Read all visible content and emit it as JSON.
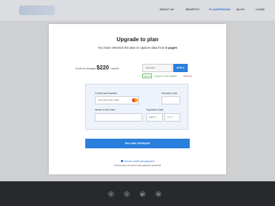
{
  "nav": {
    "items": [
      "ABOUT US",
      "BENEFITS",
      "PLANS/PRICING",
      "BLOG",
      "LOGIN"
    ],
    "active": "PLANS/PRICING"
  },
  "modal": {
    "title": "Upgrade to plan",
    "subtitle_pre": "You have selected the plan to capture data from ",
    "subtitle_bold": "3 pages",
    "charged_pre": "You'll be charged",
    "charged_amount": "$220",
    "charged_post": "/ month",
    "coupon_placeholder": "ABT4MK",
    "apply_label": "APPLY",
    "discount_badge": "15% off",
    "coupon_applied": "Coupon Code Applied",
    "remove_label": "Remove"
  },
  "payment": {
    "card_number_label": "Credit Card Number",
    "card_number_placeholder": "1234 5678 9012 3456",
    "security_code_label": "Security Code",
    "name_label": "Name on the Card",
    "expiration_label": "Expiration Date",
    "exp_month_placeholder": "MM/YY",
    "exp_year_placeholder": "YYYY",
    "pay_button": "PAY AND UPGRADE"
  },
  "secure": {
    "link": "Secure credit card payment",
    "note": "All accounts are secure and password protected"
  },
  "footer": {
    "social": [
      "f",
      "t",
      "g+",
      "in"
    ]
  },
  "colors": {
    "accent": "#2a7fdc",
    "success": "#4aa84a",
    "danger": "#d64545",
    "footer_bg": "#28292c"
  }
}
